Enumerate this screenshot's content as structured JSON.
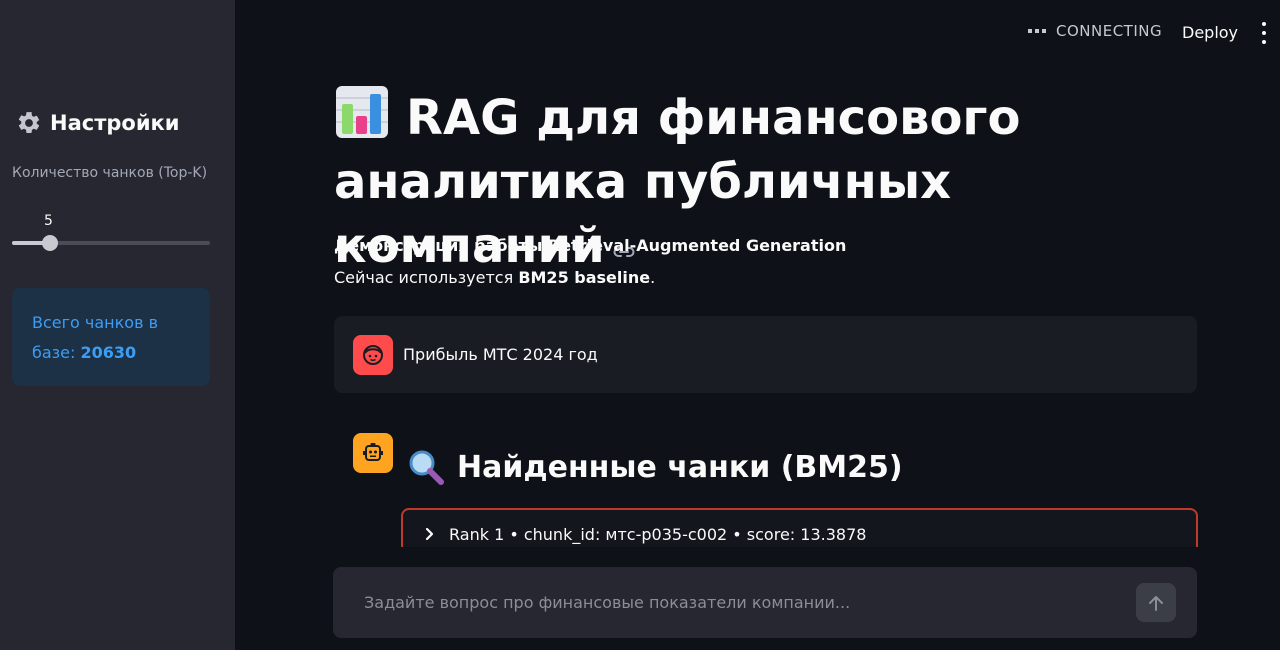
{
  "topbar": {
    "status": "CONNECTING",
    "deploy_label": "Deploy"
  },
  "sidebar": {
    "title": "Настройки",
    "slider": {
      "label": "Количество чанков (Top-K)",
      "value": "5",
      "fraction": 0.19
    },
    "info": {
      "prefix": "Всего чанков в базе: ",
      "count": "20630"
    }
  },
  "main": {
    "title": "RAG для финансового аналитика публичных компаний",
    "subtitle": "Демонстрация работы Retrieval-Augmented Generation",
    "caption_prefix": "Сейчас используется ",
    "caption_bold": "BM25 baseline",
    "caption_suffix": ".",
    "user_message": "Прибыль МТС 2024 год",
    "section_title": "Найденные чанки (BM25)",
    "expander_label": "Rank 1 • chunk_id: мтс-p035-c002 • score: 13.3878"
  },
  "chat_input": {
    "placeholder": "Задайте вопрос про финансовые показатели компании..."
  },
  "colors": {
    "background": "#0e1117",
    "sidebar": "#262730",
    "info_bg": "#1c3146",
    "info_text": "#3d9df3",
    "user_avatar": "#ff4b4b",
    "bot_avatar": "#ffa421",
    "expander_border": "#c0392b"
  },
  "icons": {
    "title": "bar-chart-icon",
    "settings": "gear-icon",
    "section": "magnifier-icon",
    "user": "user-face-icon",
    "bot": "robot-icon",
    "send": "arrow-up-icon"
  }
}
